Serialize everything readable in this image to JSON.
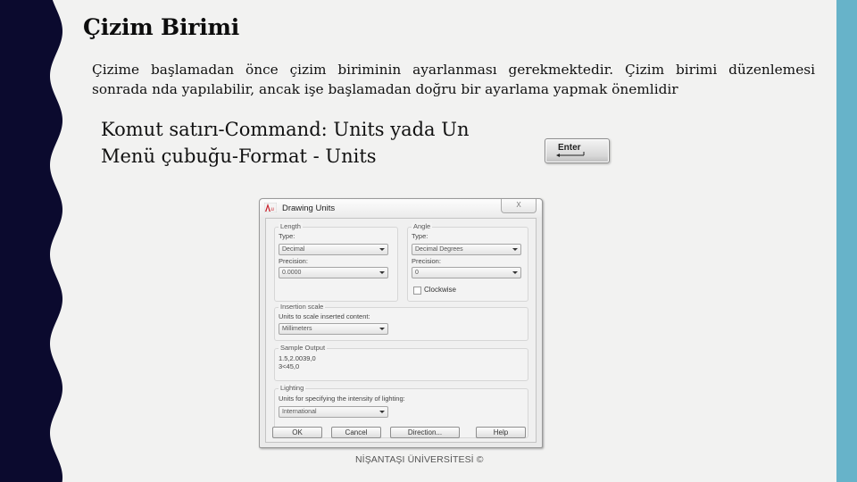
{
  "slide": {
    "title": "Çizim Birimi",
    "intro_line1": "Çizime başlamadan önce çizim biriminin ayarlanması gerekmektedir. Çizim birimi düzenlemesi",
    "intro_line2": "sonrada nda yapılabilir, ancak işe başlamadan doğru bir ayarlama yapmak önemlidir",
    "command_line": "Komut satırı-Command: Units yada Un",
    "menu_line": "Menü çubuğu-Format - Units",
    "enter_key_label": "Enter",
    "footer": "NİŞANTAŞI ÜNİVERSİTESİ ©",
    "colors": {
      "left_band": "#0b0a2e",
      "right_band": "#67b3c9",
      "background": "#f2f2f1"
    }
  },
  "dialog": {
    "title": "Drawing Units",
    "app_icon": "autocad-icon",
    "close_label": "X",
    "length": {
      "group_label": "Length",
      "type_label": "Type:",
      "type_value": "Decimal",
      "precision_label": "Precision:",
      "precision_value": "0.0000"
    },
    "angle": {
      "group_label": "Angle",
      "type_label": "Type:",
      "type_value": "Decimal Degrees",
      "precision_label": "Precision:",
      "precision_value": "0",
      "clockwise_label": "Clockwise",
      "clockwise_checked": false
    },
    "insertion_scale": {
      "group_label": "Insertion scale",
      "desc": "Units to scale inserted content:",
      "value": "Millimeters"
    },
    "sample_output": {
      "group_label": "Sample Output",
      "line1": "1.5,2.0039,0",
      "line2": "3<45,0"
    },
    "lighting": {
      "group_label": "Lighting",
      "desc": "Units for specifying the intensity of lighting:",
      "value": "International"
    },
    "buttons": {
      "ok": "OK",
      "cancel": "Cancel",
      "direction": "Direction...",
      "help": "Help"
    }
  }
}
